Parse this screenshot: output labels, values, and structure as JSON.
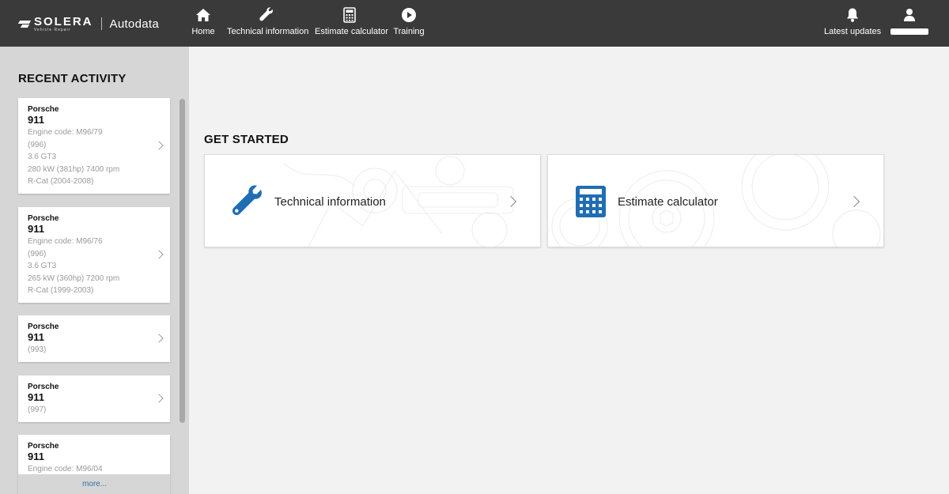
{
  "header": {
    "brand": {
      "name": "SOLERA",
      "sub": "Vehicle Repair",
      "product": "Autodata"
    },
    "nav": [
      {
        "label": "Home",
        "icon": "home-icon"
      },
      {
        "label": "Technical information",
        "icon": "wrench-icon"
      },
      {
        "label": "Estimate calculator",
        "icon": "calculator-icon"
      },
      {
        "label": "Training",
        "icon": "play-icon"
      }
    ],
    "right": {
      "updates_label": "Latest updates",
      "updates_icon": "bell-icon",
      "user_icon": "user-icon"
    }
  },
  "sidebar": {
    "title": "RECENT ACTIVITY",
    "items": [
      {
        "make": "Porsche",
        "model": "911",
        "details": [
          "Engine code: M96/79",
          "(996)",
          "3.6 GT3",
          "280 kW (381hp) 7400 rpm",
          "R-Cat (2004-2008)"
        ]
      },
      {
        "make": "Porsche",
        "model": "911",
        "details": [
          "Engine code: M96/76",
          "(996)",
          "3.6 GT3",
          "265 kW (360hp) 7200 rpm",
          "R-Cat (1999-2003)"
        ]
      },
      {
        "make": "Porsche",
        "model": "911",
        "details": [
          "(993)"
        ]
      },
      {
        "make": "Porsche",
        "model": "911",
        "details": [
          "(997)"
        ]
      },
      {
        "make": "Porsche",
        "model": "911",
        "details": [
          "Engine code: M96/04"
        ]
      }
    ],
    "more_label": "more..."
  },
  "main": {
    "section_title": "GET STARTED",
    "tiles": [
      {
        "label": "Technical information",
        "icon": "wrench-icon"
      },
      {
        "label": "Estimate calculator",
        "icon": "calculator-icon"
      }
    ]
  },
  "colors": {
    "header_bg": "#3a3a3a",
    "sidebar_bg": "#d6d6d6",
    "main_bg": "#f2f2f2",
    "accent_blue": "#1f6db5",
    "link_blue": "#3a6ea5",
    "muted_text": "#9a9a9a"
  }
}
